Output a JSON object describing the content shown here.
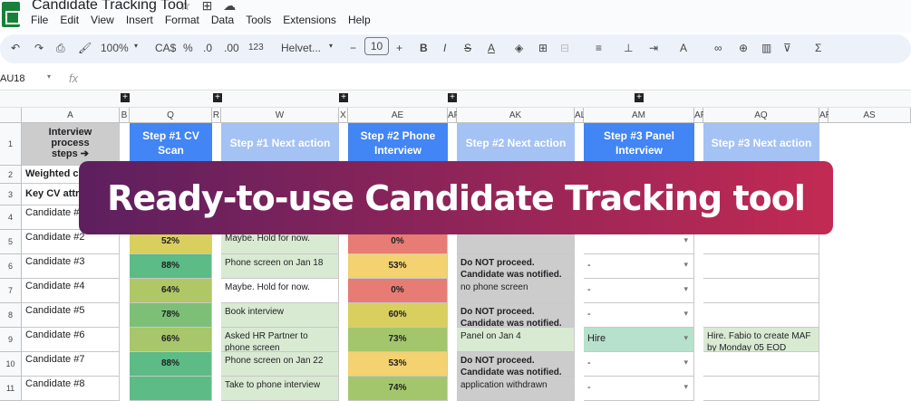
{
  "app": {
    "doc_title": "Candidate Tracking Tool",
    "menu": [
      "File",
      "Edit",
      "View",
      "Insert",
      "Format",
      "Data",
      "Tools",
      "Extensions",
      "Help"
    ],
    "toolbar": {
      "zoom": "100%",
      "currency": "CA$",
      "percent": "%",
      "dec_decrease": ".0",
      "dec_increase": ".00",
      "number_format": "123",
      "font": "Helvet...",
      "font_size": "10"
    },
    "name_box": "AU18",
    "fx": "fx"
  },
  "columns": [
    "A",
    "B",
    "Q",
    "R",
    "W",
    "X",
    "AE",
    "AF",
    "AK",
    "AL",
    "AM",
    "AP",
    "AQ",
    "AR",
    "AS"
  ],
  "rows": {
    "r1_label": "Interview process steps ➔",
    "r2_label": "Weighted cr",
    "r3_label": "Key CV attri",
    "numbers": [
      "1",
      "2",
      "3",
      "4",
      "5",
      "6",
      "7",
      "8",
      "9",
      "10",
      "11"
    ]
  },
  "steps": {
    "q": "Step #1 CV Scan",
    "w": "Step #1 Next action",
    "ae": "Step #2 Phone Interview",
    "ak": "Step #2 Next action",
    "am": "Step #3 Panel Interview",
    "aq": "Step #3 Next action"
  },
  "candidates": [
    {
      "name": "Candidate #1",
      "q": "",
      "w": "",
      "ae": "",
      "ak": "",
      "am": "",
      "aq": ""
    },
    {
      "name": "Candidate #2",
      "q": "52%",
      "w": "Maybe. Hold for now.",
      "ae": "0%",
      "ak": "",
      "am": "",
      "aq": ""
    },
    {
      "name": "Candidate #3",
      "q": "88%",
      "w": "Phone screen on Jan 18",
      "ae": "53%",
      "ak": "Do NOT proceed. Candidate was notified.",
      "am": "-",
      "aq": ""
    },
    {
      "name": "Candidate #4",
      "q": "64%",
      "w": "Maybe. Hold for now.",
      "ae": "0%",
      "ak": "no phone screen",
      "am": "-",
      "aq": ""
    },
    {
      "name": "Candidate #5",
      "q": "78%",
      "w": "Book interview",
      "ae": "60%",
      "ak": "Do NOT proceed. Candidate was notified.",
      "am": "-",
      "aq": ""
    },
    {
      "name": "Candidate #6",
      "q": "66%",
      "w": "Asked HR Partner to phone screen",
      "ae": "73%",
      "ak": "Panel on Jan 4",
      "am": "Hire",
      "aq": "Hire. Fabio to create MAF by Monday 05 EOD"
    },
    {
      "name": "Candidate #7",
      "q": "88%",
      "w": "Phone screen on Jan 22",
      "ae": "53%",
      "ak": "Do NOT proceed. Candidate was notified.",
      "am": "-",
      "aq": ""
    },
    {
      "name": "Candidate #8",
      "q": "",
      "w": "Take to phone interview",
      "ae": "74%",
      "ak": "application withdrawn",
      "am": "-",
      "aq": ""
    }
  ],
  "banner": "Ready-to-use Candidate Tracking tool",
  "colors": {
    "step_dark": "#4285f4",
    "step_light": "#a4c2f4",
    "green": "#57bb8a",
    "yellow": "#f5d76e",
    "red": "#e67c73",
    "banner_start": "#5d1f5f",
    "banner_end": "#c22a53"
  }
}
